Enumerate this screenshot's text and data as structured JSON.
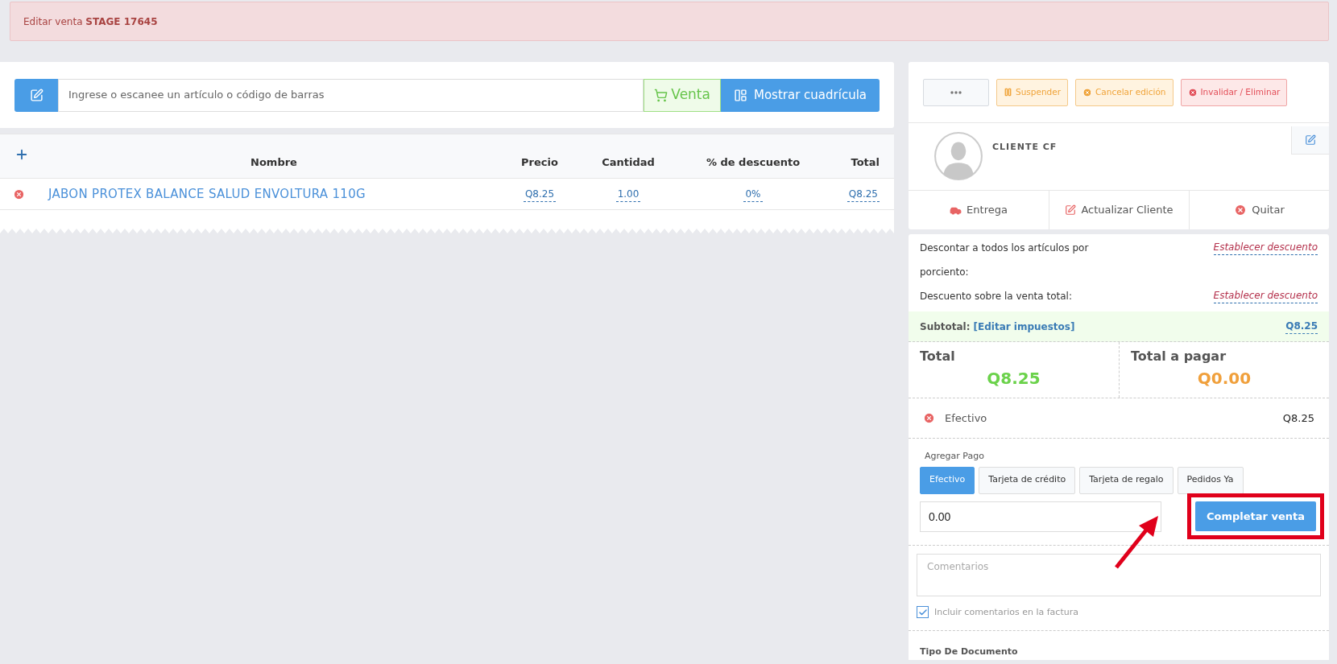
{
  "alert": {
    "label": "Editar venta",
    "sale_id": "STAGE 17645"
  },
  "search": {
    "placeholder": "Ingrese o escanee un artículo o código de barras"
  },
  "mode_buttons": [
    {
      "label": "Venta",
      "kind": "sale"
    },
    {
      "label": "Mostrar cuadrícula",
      "kind": "grid"
    }
  ],
  "table": {
    "columns": [
      "Nombre",
      "Precio",
      "Cantidad",
      "% de descuento",
      "Total"
    ],
    "rows": [
      {
        "name": "JABON PROTEX BALANCE SALUD ENVOLTURA 110G",
        "price": "Q8.25",
        "quantity": "1.00",
        "discount": "0%",
        "total": "Q8.25"
      }
    ]
  },
  "actions": [
    {
      "kind": "more"
    },
    {
      "label": "Suspender",
      "kind": "suspend"
    },
    {
      "label": "Cancelar edición",
      "kind": "cancel"
    },
    {
      "label": "Invalidar / Eliminar",
      "kind": "delete"
    }
  ],
  "customer": {
    "name": "CLIENTE CF"
  },
  "customer_actions": [
    {
      "label": "Entrega",
      "kind": "delivery"
    },
    {
      "label": "Actualizar Cliente",
      "kind": "edit"
    },
    {
      "label": "Quitar",
      "kind": "remove"
    }
  ],
  "discounts": [
    {
      "label": "Descontar a todos los artículos por porciento:",
      "link": "Establecer descuento"
    },
    {
      "label": "Descuento sobre la venta total:",
      "link": "Establecer descuento"
    }
  ],
  "subtotal": {
    "label": "Subtotal:",
    "link": "[Editar impuestos]",
    "value": "Q8.25"
  },
  "totals": [
    {
      "label": "Total",
      "value": "Q8.25",
      "kind": "total"
    },
    {
      "label": "Total a pagar",
      "value": "Q0.00",
      "kind": "due"
    }
  ],
  "payments": [
    {
      "type": "Efectivo",
      "amount": "Q8.25"
    }
  ],
  "add_payment": {
    "title": "Agregar Pago",
    "methods": [
      {
        "label": "Efectivo",
        "selected": true
      },
      {
        "label": "Tarjeta de crédito",
        "selected": false
      },
      {
        "label": "Tarjeta de regalo",
        "selected": false
      },
      {
        "label": "Pedidos Ya",
        "selected": false
      }
    ],
    "amount": "0.00",
    "submit": "Completar venta"
  },
  "comments": {
    "placeholder": "Comentarios",
    "include_label": "Incluir comentarios en la factura",
    "checked": true
  },
  "document_type": {
    "title": "Tipo De Documento"
  }
}
